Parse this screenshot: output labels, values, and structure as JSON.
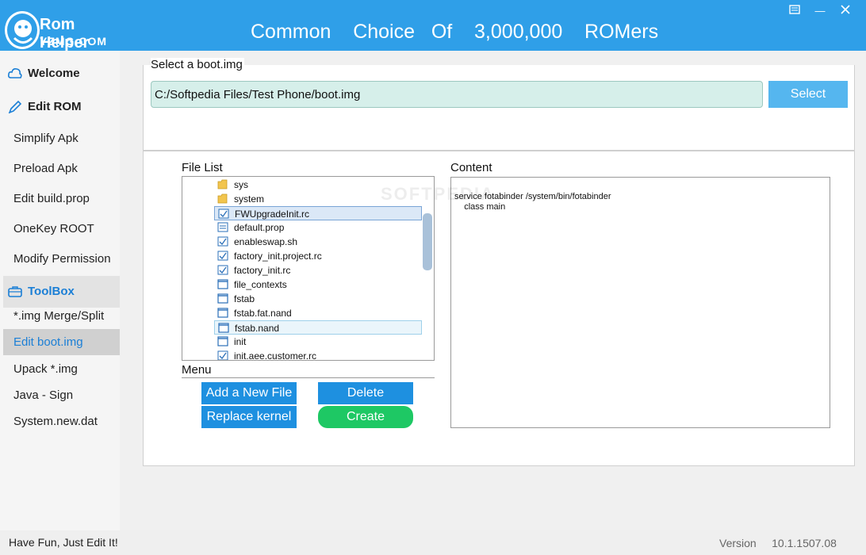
{
  "header": {
    "app_name": "Rom Helper",
    "domain": "YZMG.COM",
    "slogan": "Common    Choice   Of    3,000,000    ROMers",
    "win_menu_icon": "menu-icon",
    "win_minimize": "—"
  },
  "sidebar": {
    "welcome": "Welcome",
    "edit_rom": "Edit ROM",
    "edit_rom_items": [
      "Simplify Apk",
      "Preload Apk",
      "Edit build.prop",
      "OneKey ROOT",
      "Modify Permission"
    ],
    "toolbox": "ToolBox",
    "toolbox_items": [
      "*.img Merge/Split",
      "Edit boot.img",
      "Upack  *.img",
      "Java - Sign",
      "System.new.dat"
    ]
  },
  "boot": {
    "title": "Select a boot.img",
    "path": "C:/Softpedia Files/Test Phone/boot.img",
    "select_label": "Select"
  },
  "file_list": {
    "label": "File List",
    "items": [
      {
        "name": "sys",
        "icon": "folder-icon"
      },
      {
        "name": "system",
        "icon": "folder-icon"
      },
      {
        "name": "FWUpgradeInit.rc",
        "icon": "checked-file-icon"
      },
      {
        "name": "default.prop",
        "icon": "settings-file-icon"
      },
      {
        "name": "enableswap.sh",
        "icon": "checked-file-icon"
      },
      {
        "name": "factory_init.project.rc",
        "icon": "checked-file-icon"
      },
      {
        "name": "factory_init.rc",
        "icon": "checked-file-icon"
      },
      {
        "name": "file_contexts",
        "icon": "file-icon"
      },
      {
        "name": "fstab",
        "icon": "file-icon"
      },
      {
        "name": "fstab.fat.nand",
        "icon": "file-icon"
      },
      {
        "name": "fstab.nand",
        "icon": "file-icon"
      },
      {
        "name": "init",
        "icon": "file-icon"
      },
      {
        "name": "init.aee.customer.rc",
        "icon": "checked-file-icon"
      }
    ]
  },
  "menu": {
    "label": "Menu",
    "add_file": "Add a New File",
    "delete": "Delete",
    "replace_kernel": "Replace kernel",
    "create": "Create"
  },
  "content": {
    "label": "Content",
    "text": "service fotabinder /system/bin/fotabinder\n    class main",
    "watermark": "SOFTPEDIA"
  },
  "footer": {
    "left": "Have Fun, Just Edit It!",
    "version": "Version     10.1.1507.08"
  },
  "colors": {
    "header": "#2f9fe8",
    "accent": "#1b7fd6",
    "button_blue": "#1e90e0",
    "button_green": "#1ec864"
  }
}
